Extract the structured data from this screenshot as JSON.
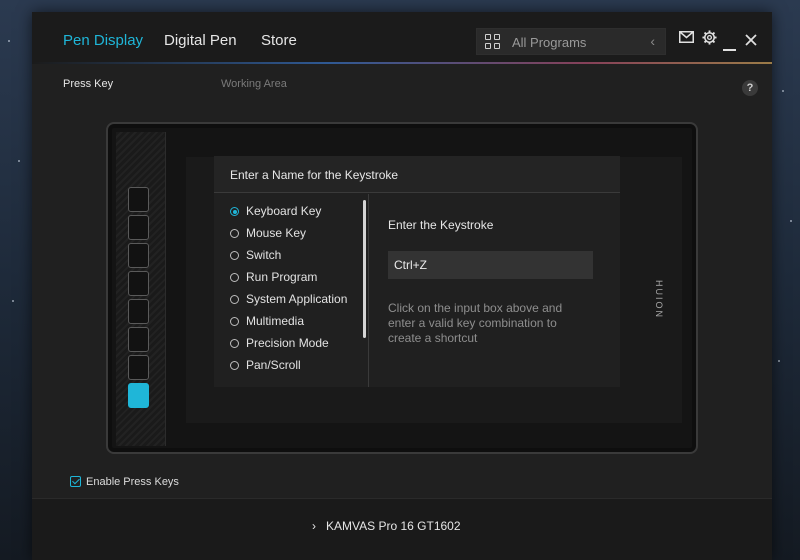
{
  "header": {
    "tabs": [
      {
        "label": "Pen Display",
        "active": true
      },
      {
        "label": "Digital Pen",
        "active": false
      },
      {
        "label": "Store",
        "active": false
      }
    ],
    "program_select": {
      "label": "All Programs",
      "icon": "grid-icon"
    },
    "icons": [
      "mail-icon",
      "gear-icon",
      "minimize-icon",
      "close-icon"
    ]
  },
  "subnav": {
    "items": [
      {
        "label": "Press Key",
        "active": true
      },
      {
        "label": "Working Area",
        "active": false
      }
    ],
    "help": "?"
  },
  "device": {
    "brand": "HUION",
    "press_keys_count": 8,
    "active_key": 8
  },
  "dialog": {
    "title": "Enter a Name for the Keystroke",
    "options": [
      {
        "label": "Keyboard Key",
        "selected": true
      },
      {
        "label": "Mouse Key",
        "selected": false
      },
      {
        "label": "Switch",
        "selected": false
      },
      {
        "label": "Run Program",
        "selected": false
      },
      {
        "label": "System Application",
        "selected": false
      },
      {
        "label": "Multimedia",
        "selected": false
      },
      {
        "label": "Precision Mode",
        "selected": false
      },
      {
        "label": "Pan/Scroll",
        "selected": false
      }
    ],
    "keystroke_title": "Enter the Keystroke",
    "keystroke_value": "Ctrl+Z",
    "hint": "Click on the input box above and enter a valid key combination to create a shortcut"
  },
  "enable_press_keys": {
    "label": "Enable Press Keys",
    "checked": true
  },
  "footer": {
    "device_name": "KAMVAS Pro 16 GT1602",
    "chevron": "›"
  },
  "colors": {
    "accent": "#1fb6d8",
    "panel": "#202020",
    "topbar": "#1b1b1b"
  }
}
